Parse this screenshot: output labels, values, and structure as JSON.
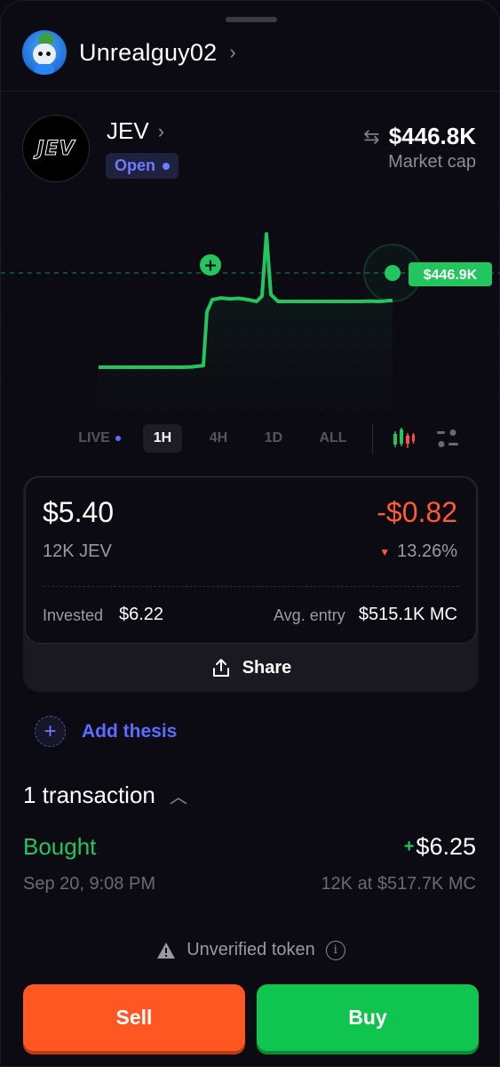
{
  "user": {
    "name": "Unrealguy02"
  },
  "token": {
    "logo_text": "JEV",
    "name": "JEV",
    "status": "Open",
    "market_cap": "$446.8K",
    "market_cap_label": "Market cap"
  },
  "chart_data": {
    "type": "line",
    "current_label": "$446.9K",
    "series": [
      {
        "values": [
          380,
          380,
          380,
          380,
          382,
          390,
          700,
          770,
          780,
          775,
          778,
          770,
          760,
          790,
          1150,
          800,
          760,
          760,
          760,
          760,
          760,
          760,
          762,
          760,
          762,
          765,
          765
        ]
      }
    ],
    "colors": {
      "line": "#22c55e",
      "bg": "#0c0b13"
    }
  },
  "ranges": [
    "LIVE",
    "1H",
    "4H",
    "1D",
    "ALL"
  ],
  "active_range": "1H",
  "icons": {
    "candles": "candles-icon",
    "settings": "sliders-icon",
    "share": "share-icon",
    "warning": "warning-icon",
    "info": "info-icon",
    "swap": "swap-icon"
  },
  "position": {
    "value": "$5.40",
    "pnl": "-$0.82",
    "amount": "12K JEV",
    "pct": "13.26%",
    "invested_label": "Invested",
    "invested": "$6.22",
    "avg_label": "Avg. entry",
    "avg": "$515.1K MC",
    "share": "Share"
  },
  "thesis": {
    "label": "Add thesis"
  },
  "transactions": {
    "header": "1 transaction",
    "items": [
      {
        "type": "Bought",
        "amount": "$6.25",
        "date": "Sep 20, 9:08 PM",
        "detail": "12K at $517.7K MC"
      }
    ]
  },
  "warning": "Unverified token",
  "actions": {
    "sell": "Sell",
    "buy": "Buy"
  },
  "colors": {
    "sell": "#ff5722",
    "buy": "#0fc44f",
    "accent": "#5b6cff",
    "up": "#22c55e",
    "down": "#ff5a36"
  }
}
